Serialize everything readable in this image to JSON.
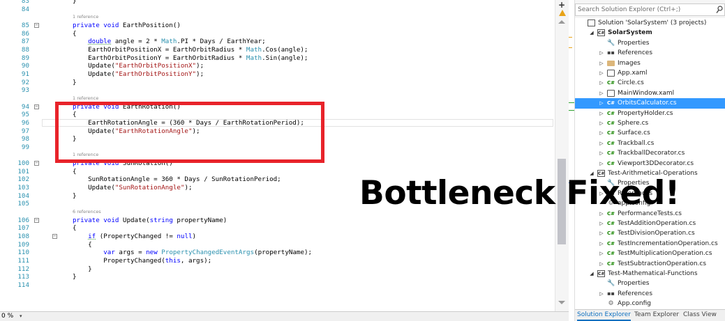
{
  "editor": {
    "zoom": "0 %",
    "lines": [
      {
        "num": "83",
        "tokens": [
          {
            "t": "}",
            "c": ""
          }
        ]
      },
      {
        "num": "84",
        "tokens": []
      },
      {
        "num": "",
        "ref": "1 reference"
      },
      {
        "num": "85",
        "fold": "−",
        "tokens": [
          {
            "t": "private void ",
            "c": "kw"
          },
          {
            "t": "EarthPosition()",
            "c": ""
          }
        ]
      },
      {
        "num": "86",
        "tokens": [
          {
            "t": "{",
            "c": ""
          }
        ]
      },
      {
        "num": "87",
        "tokens": [
          {
            "t": "    ",
            "c": ""
          },
          {
            "t": "double",
            "c": "kw sq"
          },
          {
            "t": " angle = 2 * ",
            "c": ""
          },
          {
            "t": "Math",
            "c": "ty"
          },
          {
            "t": ".PI * Days / EarthYear;",
            "c": ""
          }
        ]
      },
      {
        "num": "88",
        "tokens": [
          {
            "t": "    EarthOrbitPositionX = EarthOrbitRadius * ",
            "c": ""
          },
          {
            "t": "Math",
            "c": "ty"
          },
          {
            "t": ".Cos(angle);",
            "c": ""
          }
        ]
      },
      {
        "num": "89",
        "tokens": [
          {
            "t": "    EarthOrbitPositionY = EarthOrbitRadius * ",
            "c": ""
          },
          {
            "t": "Math",
            "c": "ty"
          },
          {
            "t": ".Sin(angle);",
            "c": ""
          }
        ]
      },
      {
        "num": "90",
        "tokens": [
          {
            "t": "    Update(",
            "c": ""
          },
          {
            "t": "\"EarthOrbitPositionX\"",
            "c": "str"
          },
          {
            "t": ");",
            "c": ""
          }
        ]
      },
      {
        "num": "91",
        "tokens": [
          {
            "t": "    Update(",
            "c": ""
          },
          {
            "t": "\"EarthOrbitPositionY\"",
            "c": "str"
          },
          {
            "t": ");",
            "c": ""
          }
        ]
      },
      {
        "num": "92",
        "tokens": [
          {
            "t": "}",
            "c": ""
          }
        ]
      },
      {
        "num": "93",
        "tokens": []
      },
      {
        "num": "",
        "ref": "1 reference"
      },
      {
        "num": "94",
        "fold": "−",
        "tokens": [
          {
            "t": "private void ",
            "c": "kw"
          },
          {
            "t": "EarthRotation()",
            "c": ""
          }
        ]
      },
      {
        "num": "95",
        "tokens": [
          {
            "t": "{",
            "c": ""
          }
        ]
      },
      {
        "num": "96",
        "cur": true,
        "tokens": [
          {
            "t": "    EarthRotationAngle = (360 * Days / EarthRotationPeriod);",
            "c": ""
          }
        ]
      },
      {
        "num": "97",
        "tokens": [
          {
            "t": "    Update(",
            "c": ""
          },
          {
            "t": "\"EarthRotationAngle\"",
            "c": "str"
          },
          {
            "t": ");",
            "c": ""
          }
        ]
      },
      {
        "num": "98",
        "tokens": [
          {
            "t": "}",
            "c": ""
          }
        ]
      },
      {
        "num": "99",
        "tokens": []
      },
      {
        "num": "",
        "ref": "1 reference"
      },
      {
        "num": "100",
        "fold": "−",
        "tokens": [
          {
            "t": "private void ",
            "c": "kw"
          },
          {
            "t": "SunRotation()",
            "c": ""
          }
        ]
      },
      {
        "num": "101",
        "tokens": [
          {
            "t": "{",
            "c": ""
          }
        ]
      },
      {
        "num": "102",
        "tokens": [
          {
            "t": "    SunRotationAngle = 360 * Days / SunRotationPeriod;",
            "c": ""
          }
        ]
      },
      {
        "num": "103",
        "tokens": [
          {
            "t": "    Update(",
            "c": ""
          },
          {
            "t": "\"SunRotationAngle\"",
            "c": "str"
          },
          {
            "t": ");",
            "c": ""
          }
        ]
      },
      {
        "num": "104",
        "tokens": [
          {
            "t": "}",
            "c": ""
          }
        ]
      },
      {
        "num": "105",
        "tokens": []
      },
      {
        "num": "",
        "ref": "6 references"
      },
      {
        "num": "106",
        "fold": "−",
        "tokens": [
          {
            "t": "private void ",
            "c": "kw"
          },
          {
            "t": "Update(",
            "c": ""
          },
          {
            "t": "string",
            "c": "kw"
          },
          {
            "t": " propertyName)",
            "c": ""
          }
        ]
      },
      {
        "num": "107",
        "tokens": [
          {
            "t": "{",
            "c": ""
          }
        ]
      },
      {
        "num": "108",
        "fold": "−",
        "foldx": 75,
        "tokens": [
          {
            "t": "    ",
            "c": ""
          },
          {
            "t": "if",
            "c": "kw sq"
          },
          {
            "t": " (PropertyChanged != ",
            "c": ""
          },
          {
            "t": "null",
            "c": "kw"
          },
          {
            "t": ")",
            "c": ""
          }
        ]
      },
      {
        "num": "109",
        "tokens": [
          {
            "t": "    {",
            "c": ""
          }
        ]
      },
      {
        "num": "110",
        "tokens": [
          {
            "t": "        ",
            "c": ""
          },
          {
            "t": "var",
            "c": "kw"
          },
          {
            "t": " args = ",
            "c": ""
          },
          {
            "t": "new",
            "c": "kw"
          },
          {
            "t": " ",
            "c": ""
          },
          {
            "t": "PropertyChangedEventArgs",
            "c": "ty"
          },
          {
            "t": "(propertyName);",
            "c": ""
          }
        ]
      },
      {
        "num": "111",
        "tokens": [
          {
            "t": "        PropertyChanged(",
            "c": ""
          },
          {
            "t": "this",
            "c": "kw"
          },
          {
            "t": ", args);",
            "c": ""
          }
        ]
      },
      {
        "num": "112",
        "tokens": [
          {
            "t": "    }",
            "c": ""
          }
        ]
      },
      {
        "num": "113",
        "tokens": [
          {
            "t": "}",
            "c": ""
          }
        ]
      },
      {
        "num": "114",
        "tokens": []
      }
    ]
  },
  "caption": "Bottleneck Fixed!",
  "solution_explorer": {
    "search_placeholder": "Search Solution Explorer (Ctrl+;)",
    "items": [
      {
        "label": "Solution 'SolarSystem' (3 projects)",
        "level": 0,
        "icon": "solution-icon",
        "exp": ""
      },
      {
        "label": "SolarSystem",
        "level": 1,
        "icon": "csharp-project-icon",
        "exp": "◢",
        "bold": true
      },
      {
        "label": "Properties",
        "level": 2,
        "icon": "properties-icon",
        "exp": ""
      },
      {
        "label": "References",
        "level": 2,
        "icon": "references-icon",
        "exp": "▷"
      },
      {
        "label": "Images",
        "level": 2,
        "icon": "folder-icon",
        "exp": "▷"
      },
      {
        "label": "App.xaml",
        "level": 2,
        "icon": "xaml-file-icon",
        "exp": "▷"
      },
      {
        "label": "Circle.cs",
        "level": 2,
        "icon": "cs-file-icon",
        "exp": "▷"
      },
      {
        "label": "MainWindow.xaml",
        "level": 2,
        "icon": "xaml-file-icon",
        "exp": "▷"
      },
      {
        "label": "OrbitsCalculator.cs",
        "level": 2,
        "icon": "cs-file-icon",
        "exp": "▷",
        "selected": true
      },
      {
        "label": "PropertyHolder.cs",
        "level": 2,
        "icon": "cs-file-icon",
        "exp": "▷"
      },
      {
        "label": "Sphere.cs",
        "level": 2,
        "icon": "cs-file-icon",
        "exp": "▷"
      },
      {
        "label": "Surface.cs",
        "level": 2,
        "icon": "cs-file-icon",
        "exp": "▷"
      },
      {
        "label": "Trackball.cs",
        "level": 2,
        "icon": "cs-file-icon",
        "exp": "▷"
      },
      {
        "label": "TrackballDecorator.cs",
        "level": 2,
        "icon": "cs-file-icon",
        "exp": "▷"
      },
      {
        "label": "Viewport3DDecorator.cs",
        "level": 2,
        "icon": "cs-file-icon",
        "exp": "▷"
      },
      {
        "label": "Test-Arithmetical-Operations",
        "level": 1,
        "icon": "csharp-project-icon",
        "exp": "◢"
      },
      {
        "label": "Properties",
        "level": 2,
        "icon": "properties-icon",
        "exp": ""
      },
      {
        "label": "References",
        "level": 2,
        "icon": "references-icon",
        "exp": "▷"
      },
      {
        "label": "app.config",
        "level": 2,
        "icon": "config-file-icon",
        "exp": ""
      },
      {
        "label": "PerformanceTests.cs",
        "level": 2,
        "icon": "cs-file-icon",
        "exp": "▷"
      },
      {
        "label": "TestAdditionOperation.cs",
        "level": 2,
        "icon": "cs-file-icon",
        "exp": "▷"
      },
      {
        "label": "TestDivisionOperation.cs",
        "level": 2,
        "icon": "cs-file-icon",
        "exp": "▷"
      },
      {
        "label": "TestIncrementationOperation.cs",
        "level": 2,
        "icon": "cs-file-icon",
        "exp": "▷"
      },
      {
        "label": "TestMultiplicationOperation.cs",
        "level": 2,
        "icon": "cs-file-icon",
        "exp": "▷"
      },
      {
        "label": "TestSubtractionOperation.cs",
        "level": 2,
        "icon": "cs-file-icon",
        "exp": "▷"
      },
      {
        "label": "Test-Mathematical-Functions",
        "level": 1,
        "icon": "csharp-project-icon",
        "exp": "◢"
      },
      {
        "label": "Properties",
        "level": 2,
        "icon": "properties-icon",
        "exp": ""
      },
      {
        "label": "References",
        "level": 2,
        "icon": "references-icon",
        "exp": "▷"
      },
      {
        "label": "App.config",
        "level": 2,
        "icon": "config-file-icon",
        "exp": ""
      }
    ],
    "tabs": [
      {
        "label": "Solution Explorer",
        "active": true
      },
      {
        "label": "Team Explorer",
        "active": false
      },
      {
        "label": "Class View",
        "active": false
      }
    ]
  },
  "colors": {
    "highlight_box": "#e8232a",
    "selection": "#3399ff",
    "keyword": "#0000ff",
    "string": "#a31515",
    "type": "#2b91af",
    "line_number": "#2b91af"
  }
}
